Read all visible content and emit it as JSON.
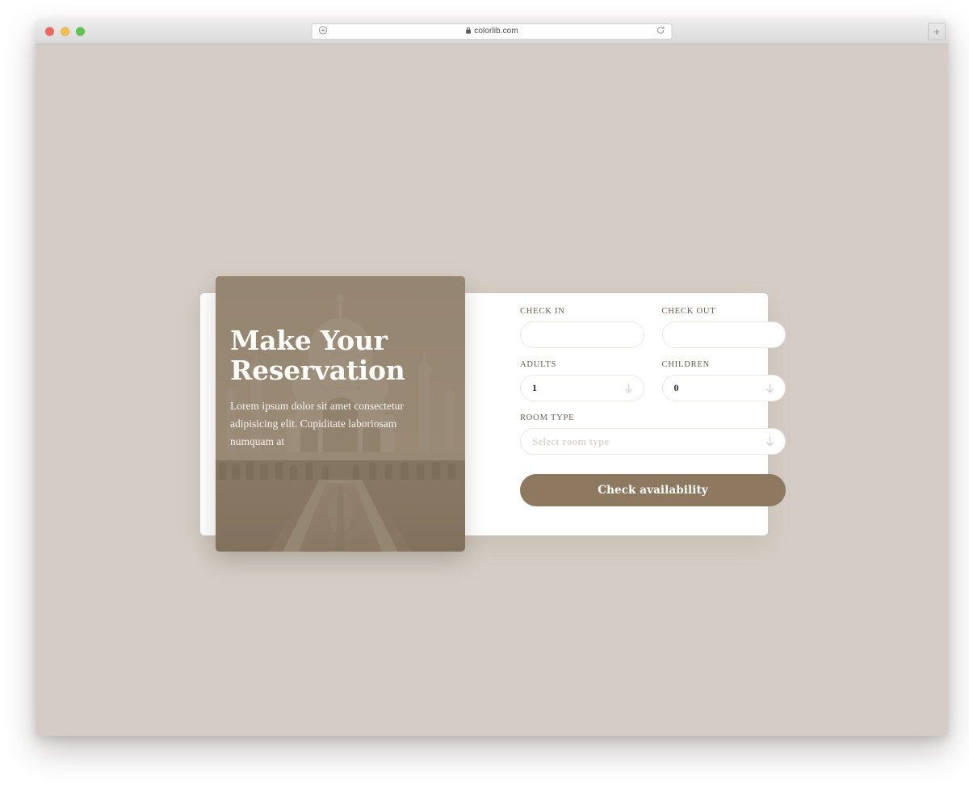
{
  "browser": {
    "url": "colorlib.com",
    "lock_icon": "lock-icon",
    "reload_icon": "reload-icon",
    "add_icon": "add-page-icon",
    "new_tab_label": "+",
    "traffic_lights": [
      "close",
      "minimize",
      "maximize"
    ]
  },
  "hero": {
    "title": "Make Your Reservation",
    "description": "Lorem ipsum dolor sit amet consectetur adipisicing elit. Cupiditate laboriosam numquam at",
    "image_alt": "taj-mahal-photo",
    "overlay_color": "#81715d"
  },
  "form": {
    "fields": [
      {
        "label": "CHECK IN",
        "value": "",
        "placeholder": "",
        "has_arrow": false,
        "name": "check-in"
      },
      {
        "label": "CHECK OUT",
        "value": "",
        "placeholder": "",
        "has_arrow": false,
        "name": "check-out"
      },
      {
        "label": "ADULTS",
        "value": "1",
        "placeholder": "",
        "has_arrow": true,
        "name": "adults"
      },
      {
        "label": "CHILDREN",
        "value": "0",
        "placeholder": "",
        "has_arrow": true,
        "name": "children"
      },
      {
        "label": "ROOM TYPE",
        "value": "",
        "placeholder": "Select room type",
        "has_arrow": true,
        "name": "room-type"
      }
    ],
    "submit_label": "Check availability",
    "arrow_icon": "arrow-down-icon"
  },
  "colors": {
    "page_background": "#d5cdc5",
    "card_background": "#ffffff",
    "accent": "#8d7860",
    "label_text": "#6b5a4a",
    "placeholder_text": "#ded8d2"
  }
}
